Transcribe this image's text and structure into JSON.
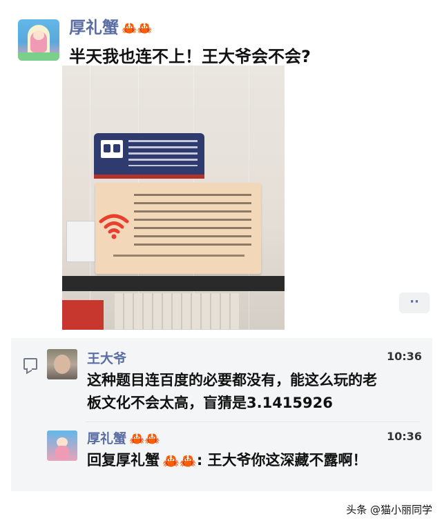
{
  "post": {
    "author": "厚礼蟹",
    "author_emoji": "🦀🦀",
    "text": "半天我也连不上！王大爷会不会?",
    "photo_icon": "wifi-sign-photo"
  },
  "more_button": {
    "label": "··"
  },
  "comments": [
    {
      "name": "王大爷",
      "time": "10:36",
      "text_line1": "这种题目连百度的必要都没有，能这么玩的老",
      "text_line2": "板文化不会太高，盲猜是3.1415926"
    },
    {
      "name": "厚礼蟹",
      "name_emoji": "🦀🦀",
      "time": "10:36",
      "reply_prefix": "回复厚礼蟹",
      "reply_emoji": "🦀🦀",
      "reply_text": ": 王大爷你这深藏不露啊！"
    }
  ],
  "watermark": "头条 @猫小丽同学",
  "colors": {
    "name": "#5b6ea3",
    "crab": "#e65728",
    "comment_bg": "#f4f5f6"
  }
}
